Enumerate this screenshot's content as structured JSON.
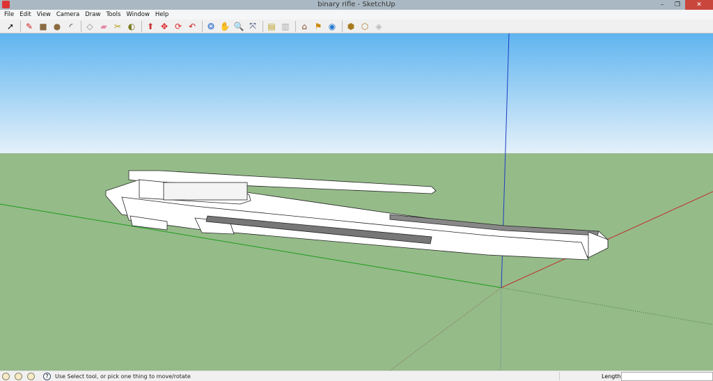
{
  "window": {
    "title": "binary rifle - SketchUp",
    "minimize": "–",
    "maximize": "❐",
    "close": "✕"
  },
  "menu": [
    "File",
    "Edit",
    "View",
    "Camera",
    "Draw",
    "Tools",
    "Window",
    "Help"
  ],
  "toolbar": [
    {
      "name": "select",
      "glyph": "➚",
      "color": "#111"
    },
    {
      "sep": true
    },
    {
      "name": "line",
      "glyph": "✎",
      "color": "#c22"
    },
    {
      "name": "rectangle",
      "glyph": "■",
      "color": "#8a6a40"
    },
    {
      "name": "circle",
      "glyph": "●",
      "color": "#8a6a40"
    },
    {
      "name": "arc",
      "glyph": "◜",
      "color": "#222"
    },
    {
      "sep": true
    },
    {
      "name": "make-component",
      "glyph": "◇",
      "color": "#888"
    },
    {
      "name": "eraser",
      "glyph": "▰",
      "color": "#e58aa8"
    },
    {
      "name": "tape-measure",
      "glyph": "✂",
      "color": "#b9a020"
    },
    {
      "name": "paint-bucket",
      "glyph": "◐",
      "color": "#7a7a20"
    },
    {
      "sep": true
    },
    {
      "name": "push-pull",
      "glyph": "⬆",
      "color": "#c33"
    },
    {
      "name": "move",
      "glyph": "✥",
      "color": "#d22"
    },
    {
      "name": "rotate",
      "glyph": "⟳",
      "color": "#d22"
    },
    {
      "name": "offset",
      "glyph": "↶",
      "color": "#c22"
    },
    {
      "sep": true
    },
    {
      "name": "orbit",
      "glyph": "❂",
      "color": "#2a6fd0"
    },
    {
      "name": "pan",
      "glyph": "✋",
      "color": "#666"
    },
    {
      "name": "zoom",
      "glyph": "🔍",
      "color": "#236"
    },
    {
      "name": "zoom-extents",
      "glyph": "⤧",
      "color": "#236"
    },
    {
      "sep": true
    },
    {
      "name": "previous-view",
      "glyph": "▤",
      "color": "#b9a020"
    },
    {
      "name": "next-view",
      "glyph": "▥",
      "color": "#aaa"
    },
    {
      "sep": true
    },
    {
      "name": "get-models",
      "glyph": "⌂",
      "color": "#8a4a30"
    },
    {
      "name": "share-model",
      "glyph": "⚑",
      "color": "#c80"
    },
    {
      "name": "google-earth",
      "glyph": "◉",
      "color": "#27c"
    },
    {
      "sep": true
    },
    {
      "name": "get-component",
      "glyph": "⬢",
      "color": "#a87a20"
    },
    {
      "name": "share-component",
      "glyph": "⬡",
      "color": "#a87a20"
    },
    {
      "name": "extension",
      "glyph": "◈",
      "color": "#bbb"
    }
  ],
  "status": {
    "message": "Use Select tool, or pick one thing to move/rotate",
    "help": "?",
    "measurement_label": "Length",
    "measurement_value": ""
  },
  "colors": {
    "sky_top": "#5fb4ef",
    "sky_bottom": "#e4f1fa",
    "ground": "#95bb89",
    "axis_red": "#c0302a",
    "axis_green": "#1a9c1a",
    "axis_blue": "#1c3ec0"
  }
}
